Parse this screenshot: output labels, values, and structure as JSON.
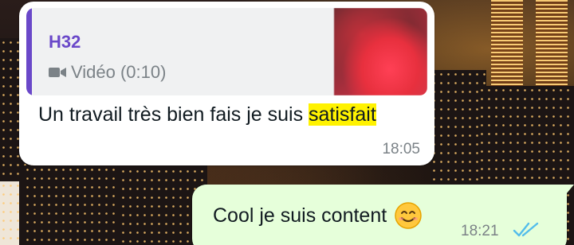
{
  "quoted": {
    "sender": "H32",
    "media_label": "Vidéo (0:10)",
    "media_icon": "video-camera-icon",
    "accent_color": "#6a48c9"
  },
  "incoming": {
    "text_before": "Un travail très bien fais je suis ",
    "text_highlight": "satisfait",
    "highlight_color": "#fff200",
    "time": "18:05"
  },
  "outgoing": {
    "text": "Cool je suis content",
    "emoji": "smiling-face-icon",
    "time": "18:21",
    "status_icon": "double-check-read-icon",
    "status_color": "#53bdeb",
    "bubble_color": "#e6ffda"
  }
}
